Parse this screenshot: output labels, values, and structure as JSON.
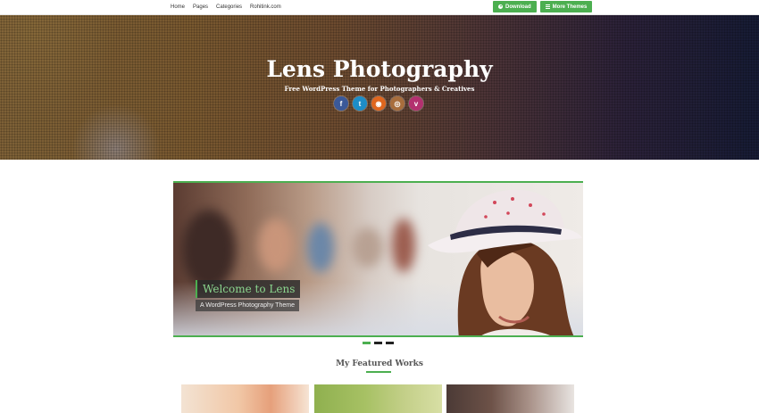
{
  "topnav": {
    "links": [
      "Home",
      "Pages",
      "Categories",
      "Rohitink.com"
    ],
    "download_label": "Download",
    "more_themes_label": "More Themes"
  },
  "hero": {
    "title": "Lens Photography",
    "subtitle": "Free WordPress Theme for Photographers & Creatives",
    "socials": [
      {
        "icon": "facebook-icon",
        "glyph": "f"
      },
      {
        "icon": "twitter-icon",
        "glyph": "t"
      },
      {
        "icon": "rss-icon",
        "glyph": "◉"
      },
      {
        "icon": "instagram-icon",
        "glyph": "◎"
      },
      {
        "icon": "vimeo-icon",
        "glyph": "v"
      }
    ]
  },
  "slider": {
    "caption_title": "Welcome to Lens",
    "caption_subtitle": "A WordPress Photography Theme",
    "slide_count": 3,
    "active_slide": 1
  },
  "featured": {
    "heading": "My Featured Works"
  },
  "colors": {
    "accent": "#4caf50",
    "text": "#333333"
  }
}
